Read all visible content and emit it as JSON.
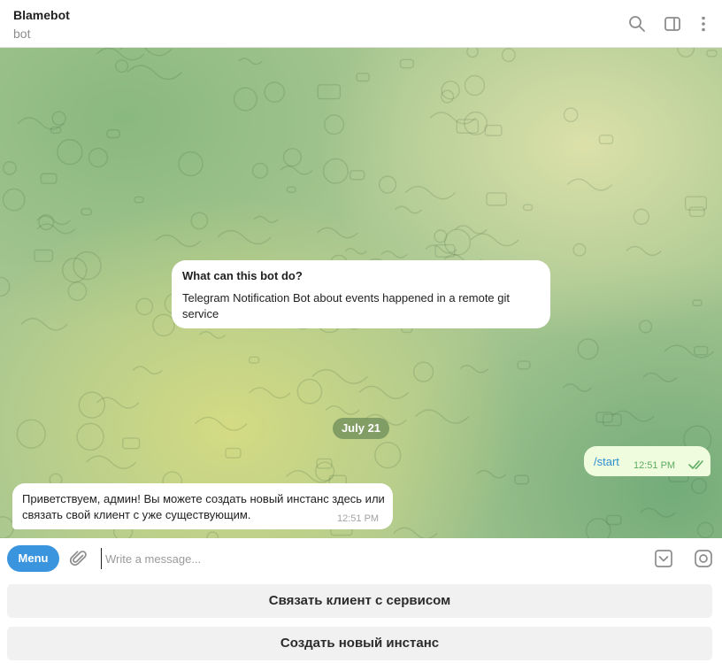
{
  "header": {
    "title": "Blamebot",
    "subtitle": "bot",
    "icons": [
      "search-icon",
      "sidebar-toggle-icon",
      "more-vertical-icon"
    ]
  },
  "bot_info": {
    "title": "What can this bot do?",
    "text": "Telegram Notification Bot about events happened in a remote git service"
  },
  "date_separator": "July 21",
  "messages": [
    {
      "direction": "outgoing",
      "text": "/start",
      "time": "12:51 PM",
      "status": "read"
    },
    {
      "direction": "incoming",
      "text": "Приветствуем, админ! Вы можете создать новый инстанс здесь или связать свой клиент с уже существующим.",
      "time": "12:51 PM"
    }
  ],
  "composer": {
    "menu_label": "Menu",
    "placeholder": "Write a message...",
    "icons": [
      "paperclip-icon",
      "bot-keyboard-icon",
      "sticker-icon"
    ]
  },
  "keyboard": {
    "buttons": [
      "Связать клиент с сервисом",
      "Создать новый инстанс"
    ]
  },
  "colors": {
    "accent": "#3a95de",
    "outgoing_bubble": "#effdde",
    "incoming_bubble": "#ffffff",
    "link": "#2f8fd1",
    "read_check": "#5fab63"
  }
}
